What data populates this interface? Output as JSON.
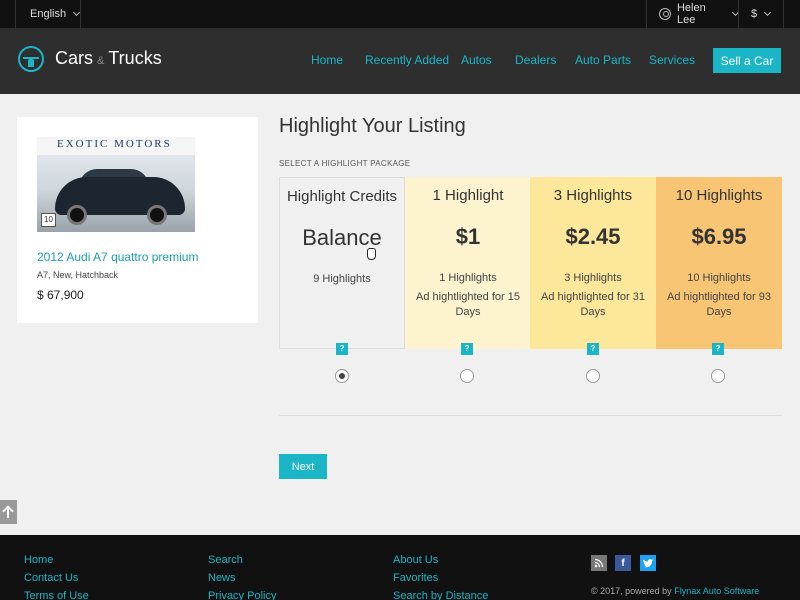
{
  "topbar": {
    "language": "English",
    "user": "Helen Lee",
    "currency": "$"
  },
  "header": {
    "brand_left": "Cars",
    "brand_amp": "&",
    "brand_right": "Trucks",
    "nav": [
      "Home",
      "Recently Added",
      "Autos",
      "Dealers",
      "Auto Parts",
      "Services"
    ],
    "sell_button": "Sell a Car"
  },
  "listing": {
    "image_banner": "EXOTIC MOTORS",
    "photo_count": "10",
    "title": "2012 Audi A7 quattro premium",
    "meta": "A7, New, Hatchback",
    "price": "$ 67,900"
  },
  "main": {
    "title": "Highlight Your Listing",
    "section_label": "SELECT A HIGHLIGHT PACKAGE",
    "help_label": "?",
    "packages": [
      {
        "name": "Highlight Credits",
        "price": "Balance",
        "count": "9 Highlights",
        "desc": "",
        "color": "#f0f0f0",
        "selected": true
      },
      {
        "name": "1 Highlight",
        "price": "$1",
        "count": "1 Highlights",
        "desc": "Ad hightlighted for 15 Days",
        "color": "#fdf3cf",
        "selected": false
      },
      {
        "name": "3 Highlights",
        "price": "$2.45",
        "count": "3 Highlights",
        "desc": "Ad hightlighted for 31 Days",
        "color": "#fce79a",
        "selected": false
      },
      {
        "name": "10 Highlights",
        "price": "$6.95",
        "count": "10 Highlights",
        "desc": "Ad hightlighted for 93 Days",
        "color": "#f8c574",
        "selected": false
      }
    ],
    "next_button": "Next"
  },
  "footer": {
    "col1": [
      "Home",
      "Contact Us",
      "Terms of Use"
    ],
    "col2": [
      "Search",
      "News",
      "Privacy Policy"
    ],
    "col3": [
      "About Us",
      "Favorites",
      "Search by Distance"
    ],
    "copyright_prefix": "© 2017, powered by",
    "copyright_link": "Flynax Auto Software"
  },
  "colors": {
    "accent": "#1ab6c8",
    "header_bg": "#2e2e2e",
    "topbar_bg": "#111111"
  }
}
